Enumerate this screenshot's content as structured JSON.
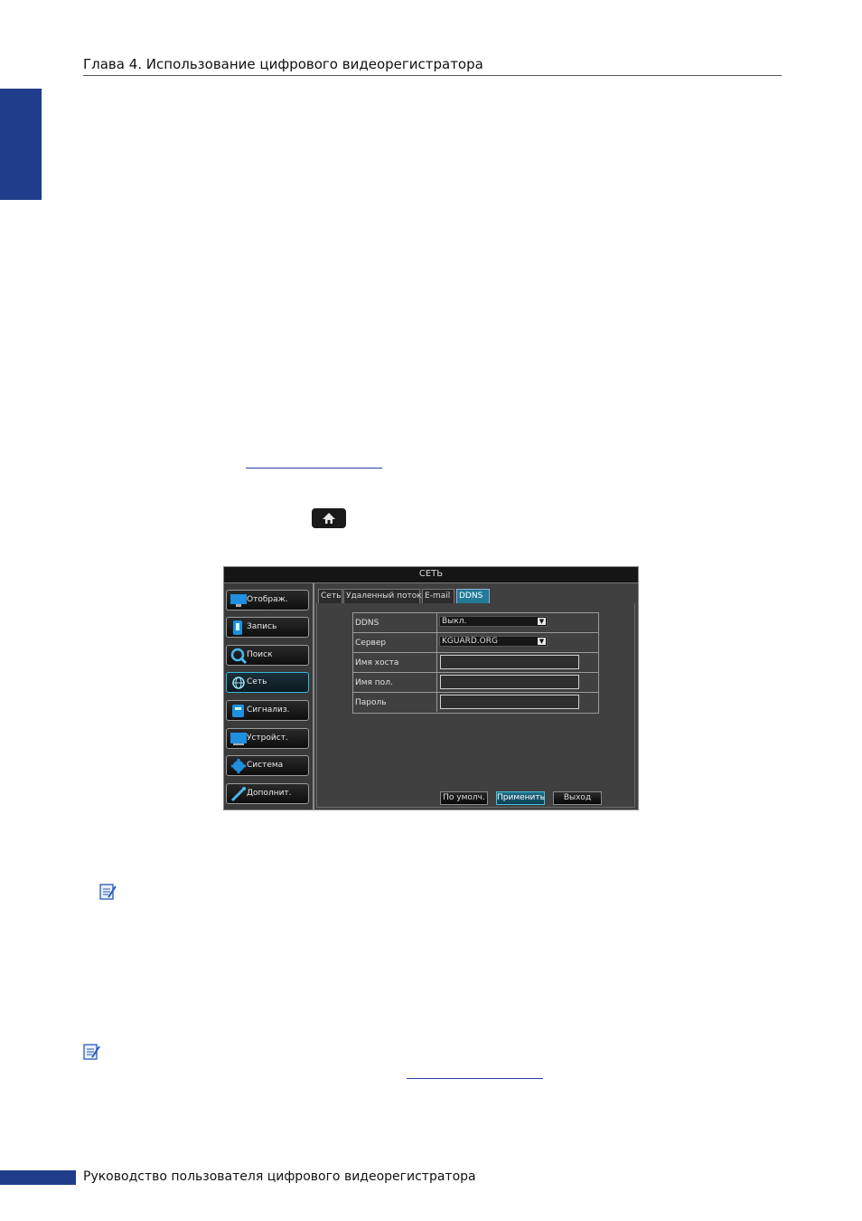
{
  "header": {
    "chapter_title": "Глава 4. Использование цифрового видеорегистратора"
  },
  "footer": {
    "text": "Руководство пользователя цифрового видеорегистратора"
  },
  "home_button": {
    "icon": "home-icon"
  },
  "dvr": {
    "window_title": "СЕТЬ",
    "menu": [
      {
        "label": "Отображ.",
        "icon": "monitor-icon"
      },
      {
        "label": "Запись",
        "icon": "record-icon"
      },
      {
        "label": "Поиск",
        "icon": "search-icon"
      },
      {
        "label": "Сеть",
        "icon": "globe-icon",
        "active": true
      },
      {
        "label": "Сигнализ.",
        "icon": "alarm-icon"
      },
      {
        "label": "Устройст.",
        "icon": "device-icon"
      },
      {
        "label": "Система",
        "icon": "gear-icon"
      },
      {
        "label": "Дополнит.",
        "icon": "wrench-icon"
      }
    ],
    "tabs": [
      "Сеть",
      "Удаленный поток",
      "E-mail",
      "DDNS"
    ],
    "active_tab": "DDNS",
    "fields": {
      "ddns": {
        "label": "DDNS",
        "value": "Выкл."
      },
      "server": {
        "label": "Сервер",
        "value": "KGUARD.ORG"
      },
      "hostname": {
        "label": "Имя хоста",
        "value": ""
      },
      "username": {
        "label": "Имя пол.",
        "value": ""
      },
      "password": {
        "label": "Пароль",
        "value": ""
      }
    },
    "buttons": {
      "default": "По умолч.",
      "apply": "Применить",
      "exit": "Выход"
    }
  },
  "colors": {
    "accent_blue": "#1f3d8a",
    "dvr_active": "#217a98",
    "link": "#2740a6"
  }
}
